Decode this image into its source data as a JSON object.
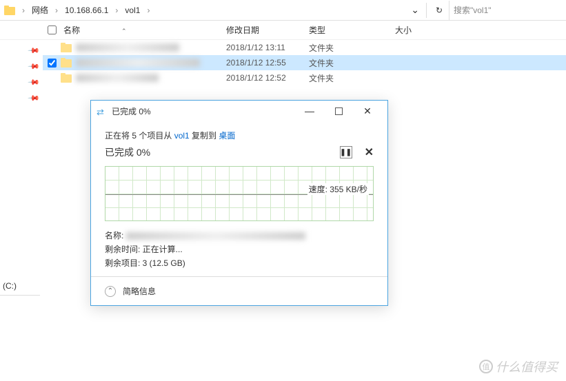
{
  "breadcrumb": {
    "root": "网络",
    "mid": "10.168.66.1",
    "leaf": "vol1",
    "dropdown_glyph": "⌄",
    "refresh_glyph": "↻"
  },
  "search": {
    "placeholder": "搜索\"vol1\""
  },
  "columns": {
    "name": "名称",
    "date": "修改日期",
    "type": "类型",
    "size": "大小"
  },
  "rows": [
    {
      "checked": false,
      "date": "2018/1/12 13:11",
      "type": "文件夹"
    },
    {
      "checked": true,
      "date": "2018/1/12 12:55",
      "type": "文件夹"
    },
    {
      "checked": false,
      "date": "2018/1/12 12:52",
      "type": "文件夹"
    }
  ],
  "sidebar": {
    "drive": "(C:)"
  },
  "dialog": {
    "title": "已完成 0%",
    "copy_prefix": "正在将 5 个项目从 ",
    "copy_src": "vol1",
    "copy_mid": " 复制到 ",
    "copy_dst": "桌面",
    "progress_label": "已完成 0%",
    "pause_glyph": "❚❚",
    "cancel_glyph": "✕",
    "speed": "速度: 355 KB/秒",
    "name_label": "名称: ",
    "remaining_time": "剩余时间: 正在计算...",
    "remaining_items": "剩余项目: 3 (12.5 GB)",
    "footer_label": "简略信息",
    "collapse_glyph": "⌃",
    "min_glyph": "—",
    "close_glyph": "✕",
    "icon_glyph": "⇄"
  },
  "watermark": {
    "text": "什么值得买",
    "badge": "值"
  },
  "chart_data": {
    "type": "line",
    "title": "",
    "xlabel": "",
    "ylabel": "速度",
    "x": [
      0
    ],
    "values": [
      355
    ],
    "unit": "KB/秒",
    "ylim": [
      0,
      1000
    ]
  }
}
